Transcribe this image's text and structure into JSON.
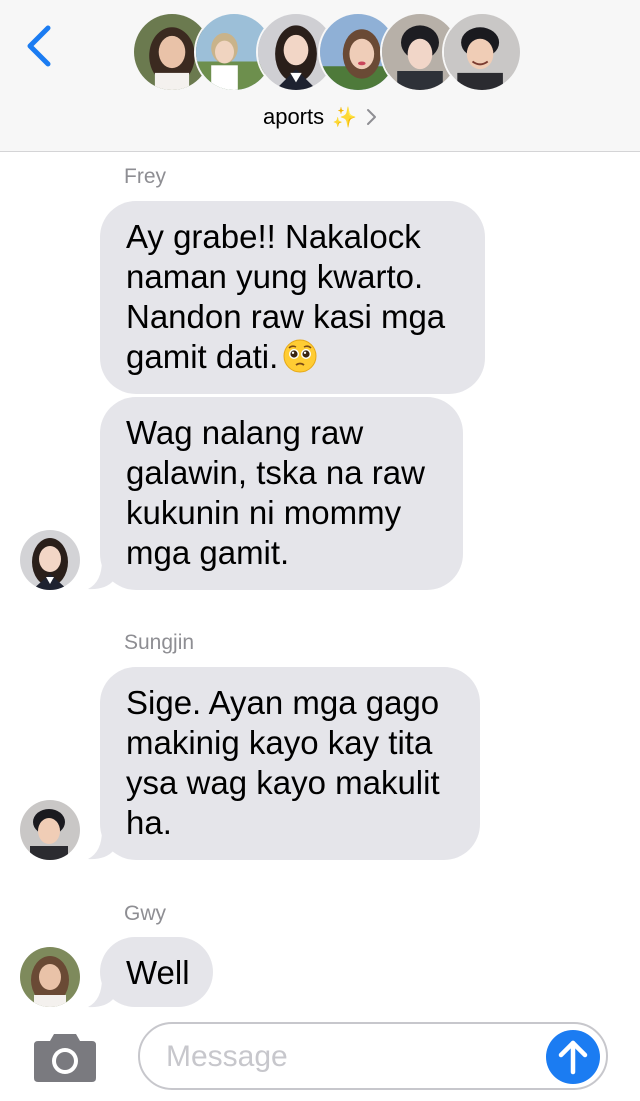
{
  "header": {
    "group_name": "aports",
    "sparkle_emoji": "✨",
    "avatars": [
      {
        "name": "member-1",
        "skin": "#e9c2a8",
        "hair": "#3b2a20",
        "bg": "#6b7a4f"
      },
      {
        "name": "member-2",
        "skin": "#f0d4c0",
        "hair": "#c9b38a",
        "bg": "#9cbfd8"
      },
      {
        "name": "member-3",
        "skin": "#f2d6c6",
        "hair": "#2a1f1a",
        "bg": "#cfcfd3"
      },
      {
        "name": "member-4",
        "skin": "#efcdb8",
        "hair": "#6a4a35",
        "bg": "#8fb0d6"
      },
      {
        "name": "member-5",
        "skin": "#f1d6c8",
        "hair": "#1d1d22",
        "bg": "#b7b0a8"
      },
      {
        "name": "member-6",
        "skin": "#f0cdb6",
        "hair": "#1a1a1f",
        "bg": "#c9c7c6"
      }
    ]
  },
  "messages": [
    {
      "sender": "Frey",
      "bubbles": [
        "Ay grabe!! Nakalock naman yung kwarto. Nandon raw kasi mga gamit dati.",
        "Wag nalang raw galawin, tska na raw kukunin ni mommy mga gamit."
      ]
    },
    {
      "sender": "Sungjin",
      "bubbles": [
        "Sige. Ayan mga gago makinig kayo kay tita ysa wag kayo makulit ha."
      ]
    },
    {
      "sender": "Gwy",
      "bubbles": [
        "Well"
      ]
    }
  ],
  "bubble_lines": {
    "b1": [
      "Ay grabe!! Nakalock",
      "naman yung kwarto.",
      "Nandon raw kasi mga",
      "gamit dati."
    ],
    "b2": [
      "Wag nalang raw",
      "galawin, tska na raw",
      "kukunin ni mommy",
      "mga gamit."
    ],
    "b3": [
      "Sige. Ayan mga gago",
      "makinig kayo kay tita",
      "ysa wag kayo makulit",
      "ha."
    ],
    "b4": [
      "Well"
    ]
  },
  "input": {
    "placeholder": "Message",
    "value": ""
  },
  "colors": {
    "accent": "#1b7cf2",
    "bubble_gray": "#e5e5ea",
    "sender_gray": "#8e8e93"
  },
  "icons": {
    "back": "chevron-left-icon",
    "camera": "camera-icon",
    "send": "arrow-up-icon",
    "details": "chevron-right-icon",
    "emoji": "pleading-face-emoji"
  }
}
